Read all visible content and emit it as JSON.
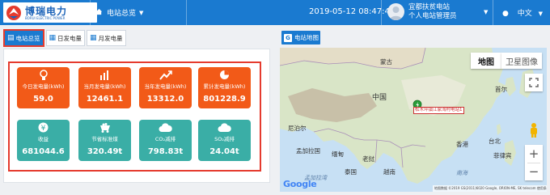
{
  "header": {
    "logo_cn": "博瑞电力",
    "logo_en": "BORUI ELECTRIC POWER",
    "nav_label": "电站总览",
    "datetime": "2019-05-12 08:47:49",
    "station_name": "宜都扶贫电站",
    "user_role": "个人电站管理员",
    "language": "中文"
  },
  "tabs": [
    {
      "label": "电站总览",
      "active": true
    },
    {
      "label": "日发电量",
      "active": false
    },
    {
      "label": "月发电量",
      "active": false
    }
  ],
  "cards": [
    {
      "label": "今日发电量(kWh)",
      "value": "59.0",
      "icon": "lightbulb-icon",
      "color": "#f25a18"
    },
    {
      "label": "当月发电量(kWh)",
      "value": "12461.1",
      "icon": "bar-chart-icon",
      "color": "#f25a18"
    },
    {
      "label": "当年发电量(kWh)",
      "value": "13312.0",
      "icon": "trend-line-icon",
      "color": "#f25a18"
    },
    {
      "label": "累计发电量(kWh)",
      "value": "801228.9",
      "icon": "pie-chart-icon",
      "color": "#f25a18"
    },
    {
      "label": "收益",
      "value": "681044.6",
      "icon": "yen-icon",
      "color": "#3aaea6"
    },
    {
      "label": "节省标准煤",
      "value": "320.49t",
      "icon": "coal-cart-icon",
      "color": "#3aaea6"
    },
    {
      "label": "CO₂减排",
      "value": "798.83t",
      "icon": "co2-cloud-icon",
      "color": "#3aaea6"
    },
    {
      "label": "SO₂减排",
      "value": "24.04t",
      "icon": "so2-cloud-icon",
      "color": "#3aaea6"
    }
  ],
  "map": {
    "title": "电站地图",
    "type_map": "地图",
    "type_satellite": "卫星图像",
    "marker_label": "松木坪镇江家湾村电站1",
    "labels": {
      "mongolia": "蒙古",
      "china": "中国",
      "nepal": "尼泊尔",
      "bangladesh": "孟加拉国",
      "myanmar": "缅甸",
      "thailand": "泰国",
      "laos": "老挝",
      "vietnam": "越南",
      "philippines": "菲律宾",
      "seoul": "首尔",
      "taipei": "台北",
      "hong_kong": "香港",
      "bay_of_bengal": "孟加拉湾",
      "south_china_sea": "南海"
    },
    "google": "Google",
    "attribution": "地图数据 ©2019 GS(2011)6020 Google, ORION-ME, SK telecom    使用条款"
  },
  "colors": {
    "header_blue": "#1a7ad0",
    "card_orange": "#f25a18",
    "card_teal": "#3aaea6",
    "highlight_red": "#e53b2e"
  }
}
